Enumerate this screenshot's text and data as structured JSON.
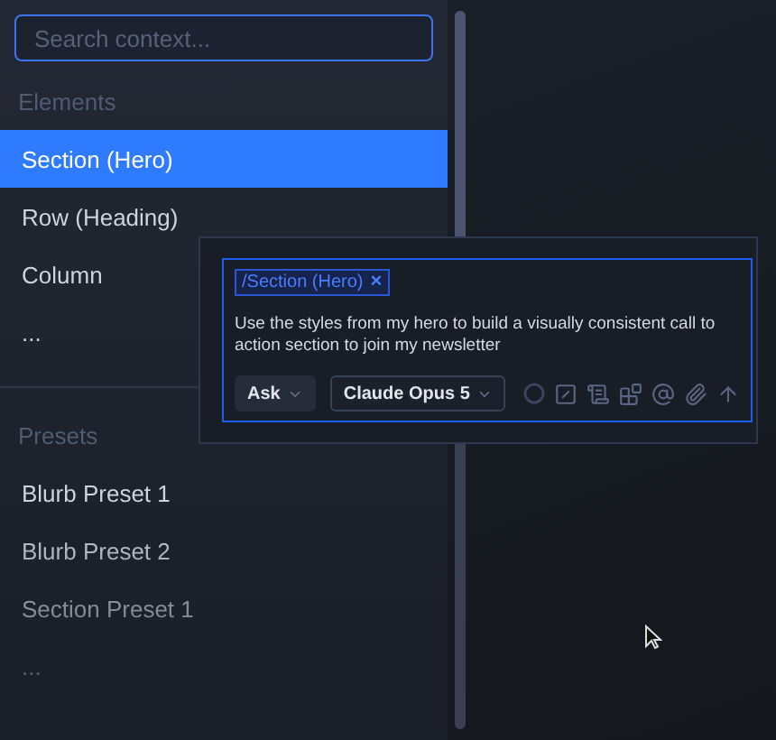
{
  "search": {
    "placeholder": "Search context..."
  },
  "sections": [
    {
      "heading": "Elements",
      "items": [
        {
          "label": "Section (Hero)",
          "selected": true
        },
        {
          "label": "Row (Heading)",
          "selected": false
        },
        {
          "label": "Column",
          "selected": false
        },
        {
          "label": "...",
          "selected": false
        }
      ]
    },
    {
      "heading": "Presets",
      "items": [
        {
          "label": "Blurb Preset 1",
          "selected": false
        },
        {
          "label": "Blurb Preset 2",
          "selected": false
        },
        {
          "label": "Section Preset 1",
          "selected": false
        },
        {
          "label": "...",
          "selected": false
        }
      ]
    }
  ],
  "prompt": {
    "chip": "/Section (Hero)",
    "chip_close": "×",
    "text": "Use the styles from my hero to build a visually consistent call to action section to join my newsletter",
    "mode": "Ask",
    "model": "Claude Opus 5"
  }
}
